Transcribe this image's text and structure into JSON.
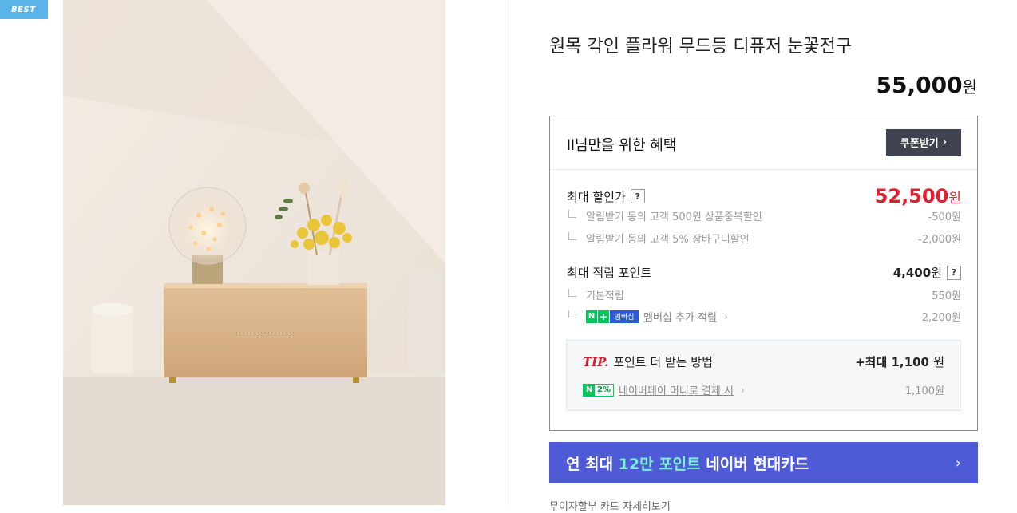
{
  "badge": "BEST",
  "product": {
    "title": "원목 각인 플라워 무드등 디퓨저 눈꽃전구",
    "price": "55,000",
    "price_unit": "원"
  },
  "benefit": {
    "heading": "ll님만을 위한 혜택",
    "coupon_button": "쿠폰받기",
    "max_discount_label": "최대 할인가",
    "help": "?",
    "max_discount_price": "52,500",
    "unit": "원",
    "discounts": [
      {
        "label": "알림받기 동의 고객 500원 상품중복할인",
        "value": "-500원"
      },
      {
        "label": "알림받기 동의 고객 5% 장바구니할인",
        "value": "-2,000원"
      }
    ],
    "points_label": "최대 적립 포인트",
    "points_value": "4,400",
    "basic_label": "기본적립",
    "basic_value": "550원",
    "membership_badge_n": "N",
    "membership_badge_plus": "+",
    "membership_badge_text": "멤버십",
    "membership_label": "멤버십 추가 적립",
    "membership_value": "2,200원",
    "tip_word": "TIP.",
    "tip_text": "포인트 더 받는 방법",
    "tip_value_prefix": "+최대",
    "tip_value": "1,100",
    "tip_value_unit": "원",
    "npay_badge": "2%",
    "npay_label": "네이버페이 머니로 결제 시",
    "npay_value": "1,100원"
  },
  "card_banner": {
    "pre": "연 최대 ",
    "highlight": "12만 포인트",
    "post": " 네이버 현대카드"
  },
  "bottom_text": "무이자할부 카드 자세히보기"
}
